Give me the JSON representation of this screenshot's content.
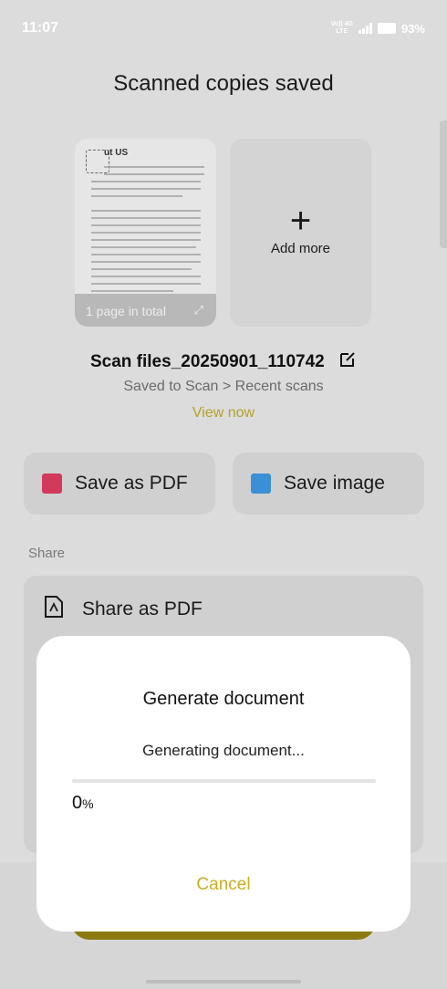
{
  "status_bar": {
    "time": "11:07",
    "network_top": "Vo)) 4G",
    "network_bottom": "LTE",
    "battery_percent": "93%"
  },
  "header": {
    "title": "Scanned copies saved"
  },
  "preview": {
    "doc_heading": "ut US",
    "page_count_text": "1 page in total",
    "add_more_label": "Add more"
  },
  "file": {
    "name": "Scan files_20250901_110742",
    "saved_location": "Saved to Scan > Recent scans",
    "view_now_label": "View now"
  },
  "actions": {
    "save_pdf_label": "Save as PDF",
    "save_image_label": "Save image",
    "pdf_color": "#d13a5a",
    "image_color": "#3a8fd6"
  },
  "share": {
    "section_label": "Share",
    "share_pdf_label": "Share as PDF"
  },
  "dialog": {
    "title": "Generate document",
    "message": "Generating document...",
    "progress_value": "0",
    "progress_unit": "%",
    "progress_fraction": 0,
    "cancel_label": "Cancel",
    "accent_color": "#c9ad22"
  }
}
